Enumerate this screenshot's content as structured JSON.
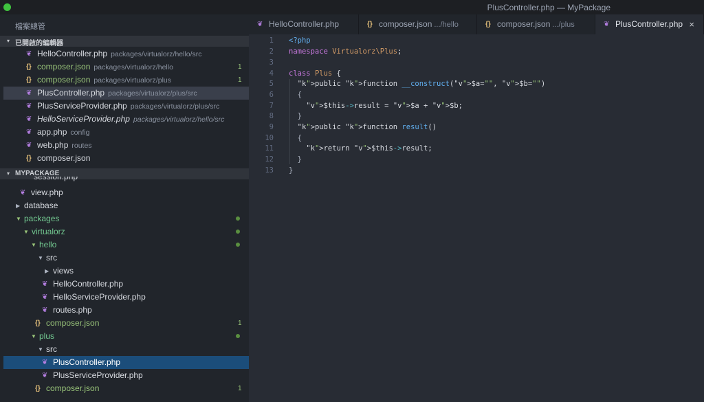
{
  "window": {
    "title": "PlusController.php — MyPackage"
  },
  "sidebar": {
    "header": "檔案總管",
    "open_editors": {
      "label": "已開啟的編輯器",
      "items": [
        {
          "name": "HelloController.php",
          "path": "packages/virtualorz/hello/src",
          "icon": "php-icon",
          "badge": ""
        },
        {
          "name": "composer.json",
          "path": "packages/virtualorz/hello",
          "icon": "json-icon",
          "badge": "1"
        },
        {
          "name": "composer.json",
          "path": "packages/virtualorz/plus",
          "icon": "json-icon",
          "badge": "1"
        },
        {
          "name": "PlusController.php",
          "path": "packages/virtualorz/plus/src",
          "icon": "php-icon",
          "badge": ""
        },
        {
          "name": "PlusServiceProvider.php",
          "path": "packages/virtualorz/plus/src",
          "icon": "php-icon",
          "badge": ""
        },
        {
          "name": "HelloServiceProvider.php",
          "path": "packages/virtualorz/hello/src",
          "icon": "php-icon",
          "badge": ""
        },
        {
          "name": "app.php",
          "path": "config",
          "icon": "php-icon",
          "badge": ""
        },
        {
          "name": "web.php",
          "path": "routes",
          "icon": "php-icon",
          "badge": ""
        },
        {
          "name": "composer.json",
          "path": "",
          "icon": "json-icon",
          "badge": ""
        }
      ]
    },
    "project": {
      "label": "MYPACKAGE",
      "partial_item": "session.php",
      "items": [
        {
          "name": "view.php",
          "type": "file"
        },
        {
          "name": "database",
          "type": "folder"
        },
        {
          "name": "packages",
          "type": "folder"
        },
        {
          "name": "virtualorz",
          "type": "folder"
        },
        {
          "name": "hello",
          "type": "folder"
        },
        {
          "name": "src",
          "type": "folder"
        },
        {
          "name": "views",
          "type": "folder"
        },
        {
          "name": "HelloController.php",
          "type": "file"
        },
        {
          "name": "HelloServiceProvider.php",
          "type": "file"
        },
        {
          "name": "routes.php",
          "type": "file"
        },
        {
          "name": "composer.json",
          "type": "file",
          "badge": "1"
        },
        {
          "name": "plus",
          "type": "folder"
        },
        {
          "name": "src",
          "type": "folder"
        },
        {
          "name": "PlusController.php",
          "type": "file"
        },
        {
          "name": "PlusServiceProvider.php",
          "type": "file"
        },
        {
          "name": "composer.json",
          "type": "file",
          "badge": "1"
        }
      ]
    }
  },
  "tabs": [
    {
      "name": "HelloController.php",
      "hint": ""
    },
    {
      "name": "composer.json",
      "hint": ".../hello"
    },
    {
      "name": "composer.json",
      "hint": ".../plus"
    },
    {
      "name": "PlusController.php",
      "hint": "",
      "close": "×"
    }
  ],
  "editor": {
    "lines": [
      {
        "n": "1",
        "text": "<?php"
      },
      {
        "n": "2",
        "text": "namespace Virtualorz\\Plus;"
      },
      {
        "n": "3",
        "text": ""
      },
      {
        "n": "4",
        "text": "class Plus {"
      },
      {
        "n": "5",
        "text": "  public function __construct($a=\"\", $b=\"\")"
      },
      {
        "n": "6",
        "text": "  {"
      },
      {
        "n": "7",
        "text": "    $this->result = $a + $b;"
      },
      {
        "n": "8",
        "text": "  }"
      },
      {
        "n": "9",
        "text": "  public function result()"
      },
      {
        "n": "10",
        "text": "  {"
      },
      {
        "n": "11",
        "text": "    return $this->result;"
      },
      {
        "n": "12",
        "text": "  }"
      },
      {
        "n": "13",
        "text": "}"
      }
    ]
  },
  "icons": {
    "php": "❦",
    "json": "{}"
  }
}
